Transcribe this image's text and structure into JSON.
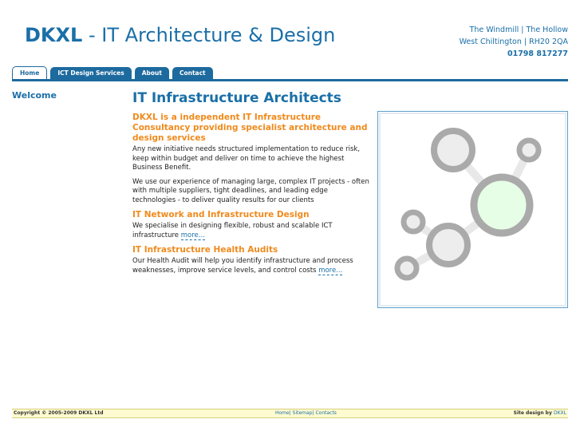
{
  "header": {
    "brand": "DKXL",
    "tagline": " - IT Architecture & Design",
    "address_line1": "The Windmill | The Hollow",
    "address_line2": "West Chiltington | RH20 2QA",
    "phone": "01798 817277"
  },
  "nav": {
    "tabs": [
      {
        "label": "Home",
        "active": true
      },
      {
        "label": "ICT Design Services",
        "active": false
      },
      {
        "label": "About",
        "active": false
      },
      {
        "label": "Contact",
        "active": false
      }
    ]
  },
  "sidebar": {
    "welcome": "Welcome"
  },
  "main": {
    "title": "IT Infrastructure Architects",
    "intro_heading": "DKXL is a independent IT Infrastructure Consultancy providing specialist architecture and design services",
    "intro_p1": "Any new initiative needs structured implementation to reduce risk, keep within budget and deliver on time to achieve the highest Business Benefit.",
    "intro_p2": "We use our experience of managing large, complex IT projects - often with multiple suppliers, tight deadlines, and leading edge technologies - to deliver quality results for our clients",
    "section1_heading": "IT Network and Infrastructure Design",
    "section1_text": "We specialise in designing flexible, robust and scalable ICT infrastructure ",
    "section1_more": "more...",
    "section2_heading": "IT Infrastructure Health Audits",
    "section2_text": "Our Health Audit will help you identify infrastructure and process weaknesses, improve service levels, and control costs ",
    "section2_more": "more..."
  },
  "colors": {
    "accent": "#1a6fa8",
    "orange": "#f08a1c",
    "node_gray": "#aaaaaa",
    "node_green": "#e6fde6"
  },
  "footer": {
    "copyright": "Copyright © 2005-2009 DKXL Ltd",
    "link_home": "Home",
    "link_sitemap": "Sitemap",
    "link_contacts": "Contacts",
    "credit_prefix": "Site design by ",
    "credit_link": "DKXL"
  }
}
